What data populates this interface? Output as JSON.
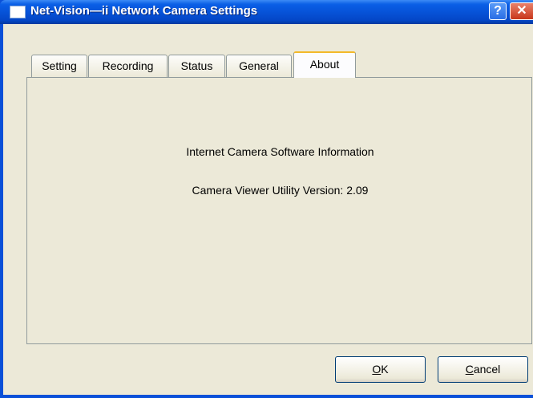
{
  "window": {
    "title": "Net-Vision—ii Network Camera Settings",
    "help_label": "?",
    "close_label": "✕"
  },
  "tabs": [
    {
      "label": "Setting",
      "active": false
    },
    {
      "label": "Recording",
      "active": false
    },
    {
      "label": "Status",
      "active": false
    },
    {
      "label": "General",
      "active": false
    },
    {
      "label": "About",
      "active": true
    }
  ],
  "about": {
    "heading": "Internet Camera Software Information",
    "version_text": "Camera Viewer Utility Version: 2.09"
  },
  "buttons": {
    "ok_accel": "O",
    "ok_rest": "K",
    "cancel_accel": "C",
    "cancel_rest": "ancel"
  },
  "colors": {
    "titlebar": "#0651d6",
    "dialog_bg": "#ece9d8",
    "active_tab_highlight": "#f3b92a"
  }
}
